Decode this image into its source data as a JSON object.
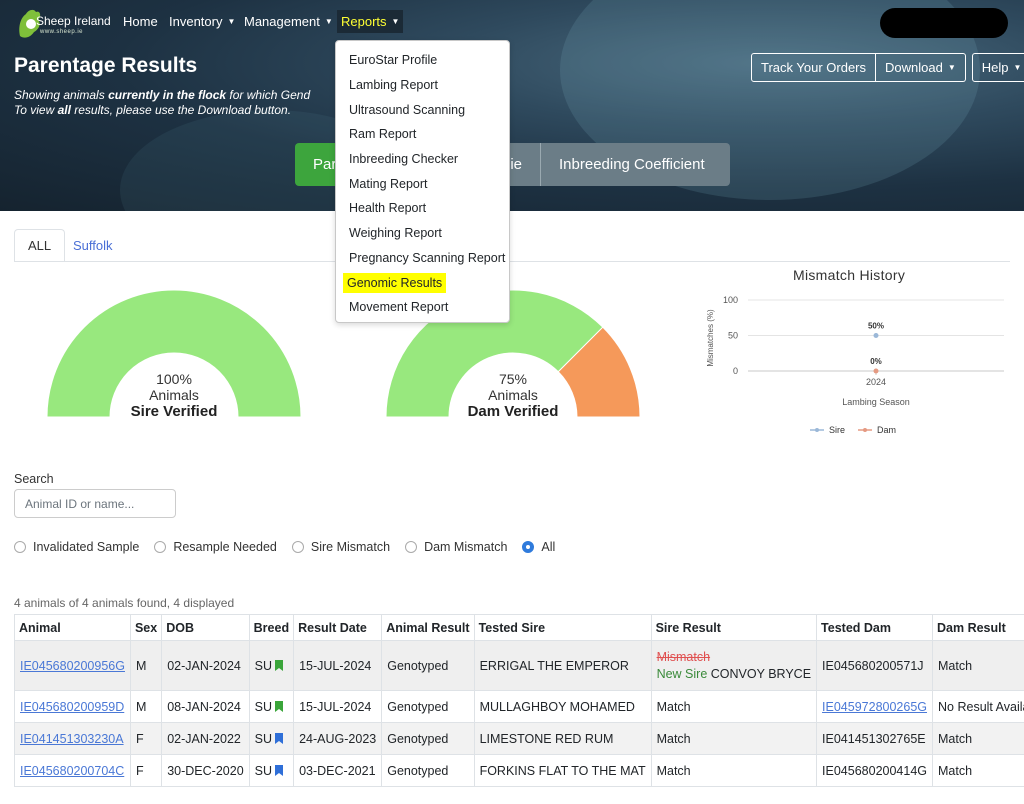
{
  "nav": {
    "logo_text": "Sheep Ireland",
    "logo_sub": "www.sheep.ie",
    "items": [
      {
        "label": "Home"
      },
      {
        "label": "Inventory"
      },
      {
        "label": "Management"
      },
      {
        "label": "Reports"
      }
    ]
  },
  "header": {
    "title": "Parentage Results",
    "subtitle_line1_a": "Showing animals ",
    "subtitle_line1_b": "currently in the flock",
    "subtitle_line1_c": " for which Gend",
    "subtitle_line2_a": "To view ",
    "subtitle_line2_b": "all",
    "subtitle_line2_c": " results, please use the Download button.",
    "buttons": {
      "track": "Track Your Orders",
      "download": "Download",
      "help": "Help"
    },
    "toggle": {
      "first": "Par",
      "second": "ie",
      "third": "Inbreeding Coefficient"
    }
  },
  "reports_menu": [
    "EuroStar Profile",
    "Lambing Report",
    "Ultrasound Scanning",
    "Ram Report",
    "Inbreeding Checker",
    "Mating Report",
    "Health Report",
    "Weighing Report",
    "Pregnancy Scanning Report",
    "Genomic Results",
    "Movement Report"
  ],
  "reports_menu_highlighted": "Genomic Results",
  "tabs": {
    "all": "ALL",
    "suffolk": "Suffolk"
  },
  "gauges": {
    "sire": {
      "percent_text": "100%",
      "unit": "Animals",
      "caption": "Sire Verified",
      "value": 1.0
    },
    "dam": {
      "percent_text": "75%",
      "unit": "Animals",
      "caption": "Dam Verified",
      "value": 0.75
    }
  },
  "colors": {
    "verified": "#98e87e",
    "unverified": "#f5995a",
    "sire_series": "#9bb8d8",
    "dam_series": "#e59a82"
  },
  "chart_data": {
    "type": "line",
    "title": "Mismatch History",
    "xlabel": "Lambing Season",
    "ylabel": "Mismatches (%)",
    "categories": [
      "2024"
    ],
    "ylim": [
      0,
      100
    ],
    "yticks": [
      0,
      50,
      100
    ],
    "series": [
      {
        "name": "Sire",
        "values": [
          50
        ],
        "labels": [
          "50%"
        ]
      },
      {
        "name": "Dam",
        "values": [
          0
        ],
        "labels": [
          "0%"
        ]
      }
    ],
    "legend": "bottom"
  },
  "search": {
    "label": "Search",
    "placeholder": "Animal ID or name..."
  },
  "filters": {
    "options": [
      "Invalidated Sample",
      "Resample Needed",
      "Sire Mismatch",
      "Dam Mismatch",
      "All"
    ],
    "selected": "All"
  },
  "summary": "4 animals of 4 animals found, 4 displayed",
  "table": {
    "headers": [
      "Animal",
      "Sex",
      "DOB",
      "Breed",
      "Result Date",
      "Animal Result",
      "Tested Sire",
      "Sire Result",
      "Tested Dam",
      "Dam Result"
    ],
    "rows": [
      {
        "animal": "IE045680200956G",
        "sex": "M",
        "dob": "02-JAN-2024",
        "breed": "SU",
        "breed_flag": "green",
        "result_date": "15-JUL-2024",
        "animal_result": "Genotyped",
        "tested_sire": "ERRIGAL THE EMPEROR",
        "sire_result": "Mismatch",
        "sire_new_prefix": "New Sire",
        "sire_new_name": "CONVOY BRYCE",
        "tested_dam": "IE045680200571J",
        "dam_result": "Match"
      },
      {
        "animal": "IE045680200959D",
        "sex": "M",
        "dob": "08-JAN-2024",
        "breed": "SU",
        "breed_flag": "green",
        "result_date": "15-JUL-2024",
        "animal_result": "Genotyped",
        "tested_sire": "MULLAGHBOY MOHAMED",
        "sire_result": "Match",
        "tested_dam": "IE045972800265G",
        "dam_result": "No Result Available"
      },
      {
        "animal": "IE041451303230A",
        "sex": "F",
        "dob": "02-JAN-2022",
        "breed": "SU",
        "breed_flag": "blue",
        "result_date": "24-AUG-2023",
        "animal_result": "Genotyped",
        "tested_sire": "LIMESTONE RED RUM",
        "sire_result": "Match",
        "tested_dam": "IE041451302765E",
        "dam_result": "Match"
      },
      {
        "animal": "IE045680200704C",
        "sex": "F",
        "dob": "30-DEC-2020",
        "breed": "SU",
        "breed_flag": "blue",
        "result_date": "03-DEC-2021",
        "animal_result": "Genotyped",
        "tested_sire": "FORKINS FLAT TO THE MAT",
        "sire_result": "Match",
        "tested_dam": "IE045680200414G",
        "dam_result": "Match"
      }
    ]
  }
}
